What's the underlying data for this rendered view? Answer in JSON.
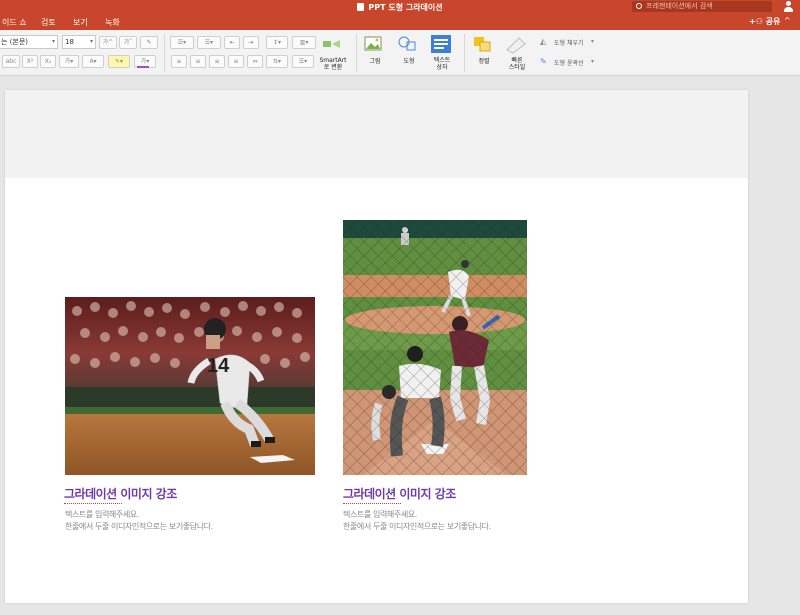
{
  "window": {
    "title": "PPT 도형 그라데이션",
    "search_placeholder": "프레젠테이션에서 검색"
  },
  "tabs": [
    {
      "label": "이드 쇼"
    },
    {
      "label": "검토"
    },
    {
      "label": "보기"
    },
    {
      "label": "녹화"
    }
  ],
  "share_label": "공유",
  "ribbon": {
    "font_name": "는 (본문)",
    "font_size": "18",
    "smartart_label_1": "SmartArt",
    "smartart_label_2": "로 변환",
    "picture_label": "그림",
    "shapes_label": "도형",
    "textbox_label_1": "텍스트",
    "textbox_label_2": "상자",
    "arrange_label": "정렬",
    "quick_styles_label_1": "빠른",
    "quick_styles_label_2": "스타일",
    "shape_fill_label": "도형 채우기",
    "shape_outline_label": "도형 윤곽선",
    "superscript": "X²",
    "subscript": "X₂"
  },
  "slide": {
    "cards": [
      {
        "title": "그라데이션 이미지 강조",
        "desc_line1": "텍스트를 입력해주세요.",
        "desc_line2": "한줄에서 두줄 이디자인적으로는 보기좋답니다.",
        "image": "baserunner-photo"
      },
      {
        "title": "그라데이션 이미지 강조",
        "desc_line1": "텍스트를 입력해주세요.",
        "desc_line2": "한줄에서 두줄 이디자인적으로는 보기좋답니다.",
        "image": "pitcher-batter-photo"
      }
    ]
  },
  "colors": {
    "titlebar": "#c8462b",
    "accent_title": "#6e3aa8"
  }
}
